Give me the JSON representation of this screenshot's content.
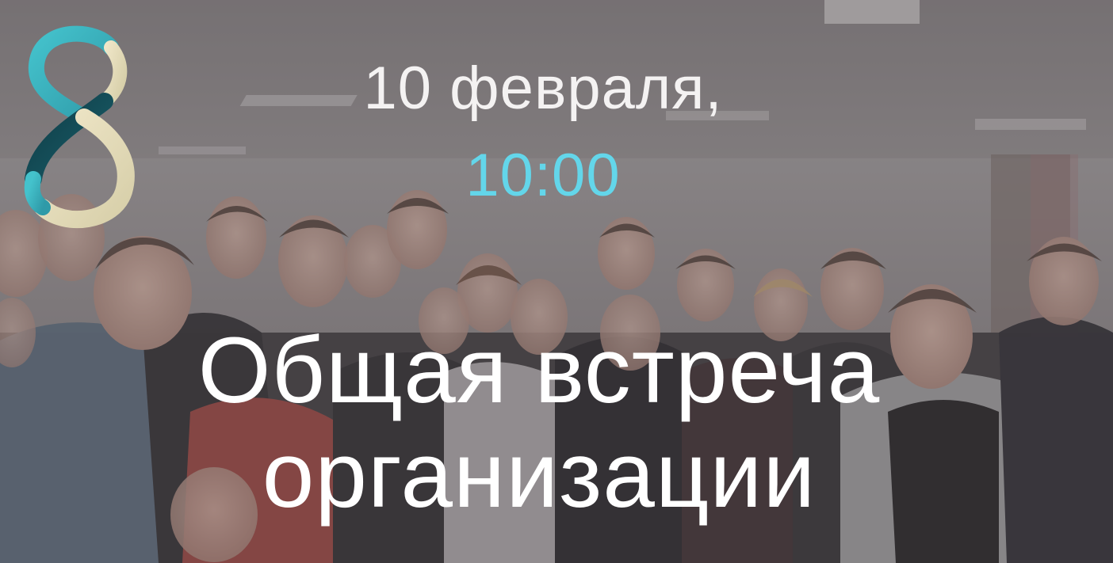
{
  "event": {
    "date": "10 февраля,",
    "time": "10:00",
    "title_line1": "Общая встреча",
    "title_line2": "организации"
  },
  "logo": {
    "icon": "figure-eight-logo-icon",
    "colors": [
      "#3fb8c4",
      "#114a55",
      "#e9e2c8"
    ]
  },
  "colors": {
    "time_accent": "#63d6ea",
    "text": "#ffffff",
    "overlay": "#504a4c"
  },
  "background": {
    "description_icon": "group-photo-image"
  }
}
